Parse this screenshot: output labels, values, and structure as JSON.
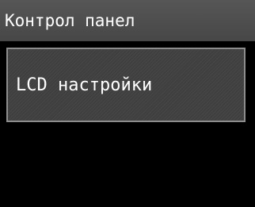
{
  "header": {
    "title": "Контрол панел"
  },
  "menu": {
    "items": [
      {
        "label": "LCD настройки"
      }
    ]
  },
  "colors": {
    "background": "#000000",
    "title_bar": "#4e4e4e",
    "item_background": "#3f3f3f",
    "item_border": "#8d8d8d",
    "text": "#ffffff"
  }
}
